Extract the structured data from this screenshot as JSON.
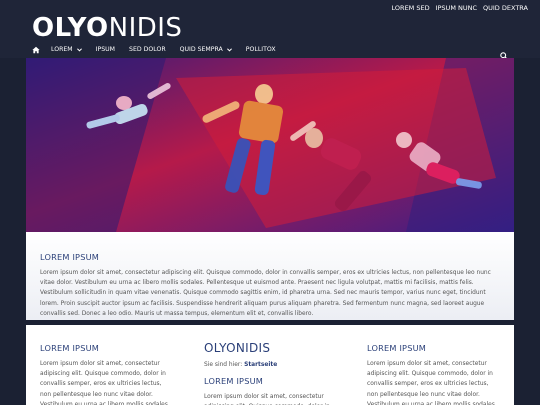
{
  "header": {
    "logo_bold": "OLYO",
    "logo_light": "NIDIS",
    "top_links": [
      "LOREM SED",
      "IPSUM NUNC",
      "QUID DEXTRA"
    ]
  },
  "nav": {
    "items": [
      "LOREM",
      "IPSUM",
      "SED DOLOR",
      "QUID SEMPRA",
      "POLLITOX"
    ],
    "dropdown_flags": [
      true,
      false,
      false,
      true,
      false
    ]
  },
  "intro": {
    "title": "LOREM IPSUM",
    "text": "Lorem ipsum dolor sit amet, consectetur adipiscing elit. Quisque commodo, dolor in convallis semper, eros ex ultricies lectus, non pellentesque leo nunc vitae dolor. Vestibulum eu urna ac libero mollis sodales. Pellentesque ut euismod ante. Praesent nec ligula volutpat, mattis mi facilisis, mattis felis. Vestibulum sollicitudin in quam vitae venenatis. Quisque commodo sagittis enim, id pharetra urna. Sed nec mauris tempor, varius nunc eget, tincidunt lorem. Proin suscipit auctor ipsum ac facilisis. Suspendisse hendrerit aliquam purus aliquam pharetra. Sed fermentum nunc magna, sed laoreet augue convallis sed. Donec a leo odio. Mauris ut massa tempus, elementum elit et, convallis libero."
  },
  "columns": {
    "left": {
      "title": "LOREM IPSUM",
      "text": "Lorem ipsum dolor sit amet, consectetur adipiscing elit. Quisque commodo, dolor in convallis semper, eros ex ultricies lectus, non pellentesque leo nunc vitae dolor. Vestibulum eu urna ac libero mollis sodales. Pellentesque ut euismod ante. Praesent nec"
    },
    "middle": {
      "site_title": "OLYONIDIS",
      "breadcrumb_label": "Sie sind hier:",
      "breadcrumb_current": "Startseite",
      "title": "LOREM IPSUM",
      "text": "Lorem ipsum dolor sit amet, consectetur adipiscing elit. Quisque commodo, dolor in convallis semper."
    },
    "right": {
      "title": "LOREM IPSUM",
      "text": "Lorem ipsum dolor sit amet, consectetur adipiscing elit. Quisque commodo, dolor in convallis semper, eros ex ultricies lectus, non pellentesque leo nunc vitae dolor. Vestibulum eu urna ac libero mollis sodales. Pellentesque ut euismod ante. Praesent nec"
    }
  },
  "colors": {
    "page_bg": "#1b2133",
    "header_bg": "#1f2538",
    "accent_blue": "#2a3f78",
    "body_text": "#555555"
  },
  "icons": {
    "home": "home-icon",
    "search": "search-icon",
    "dropdown": "chevron-down-icon"
  }
}
